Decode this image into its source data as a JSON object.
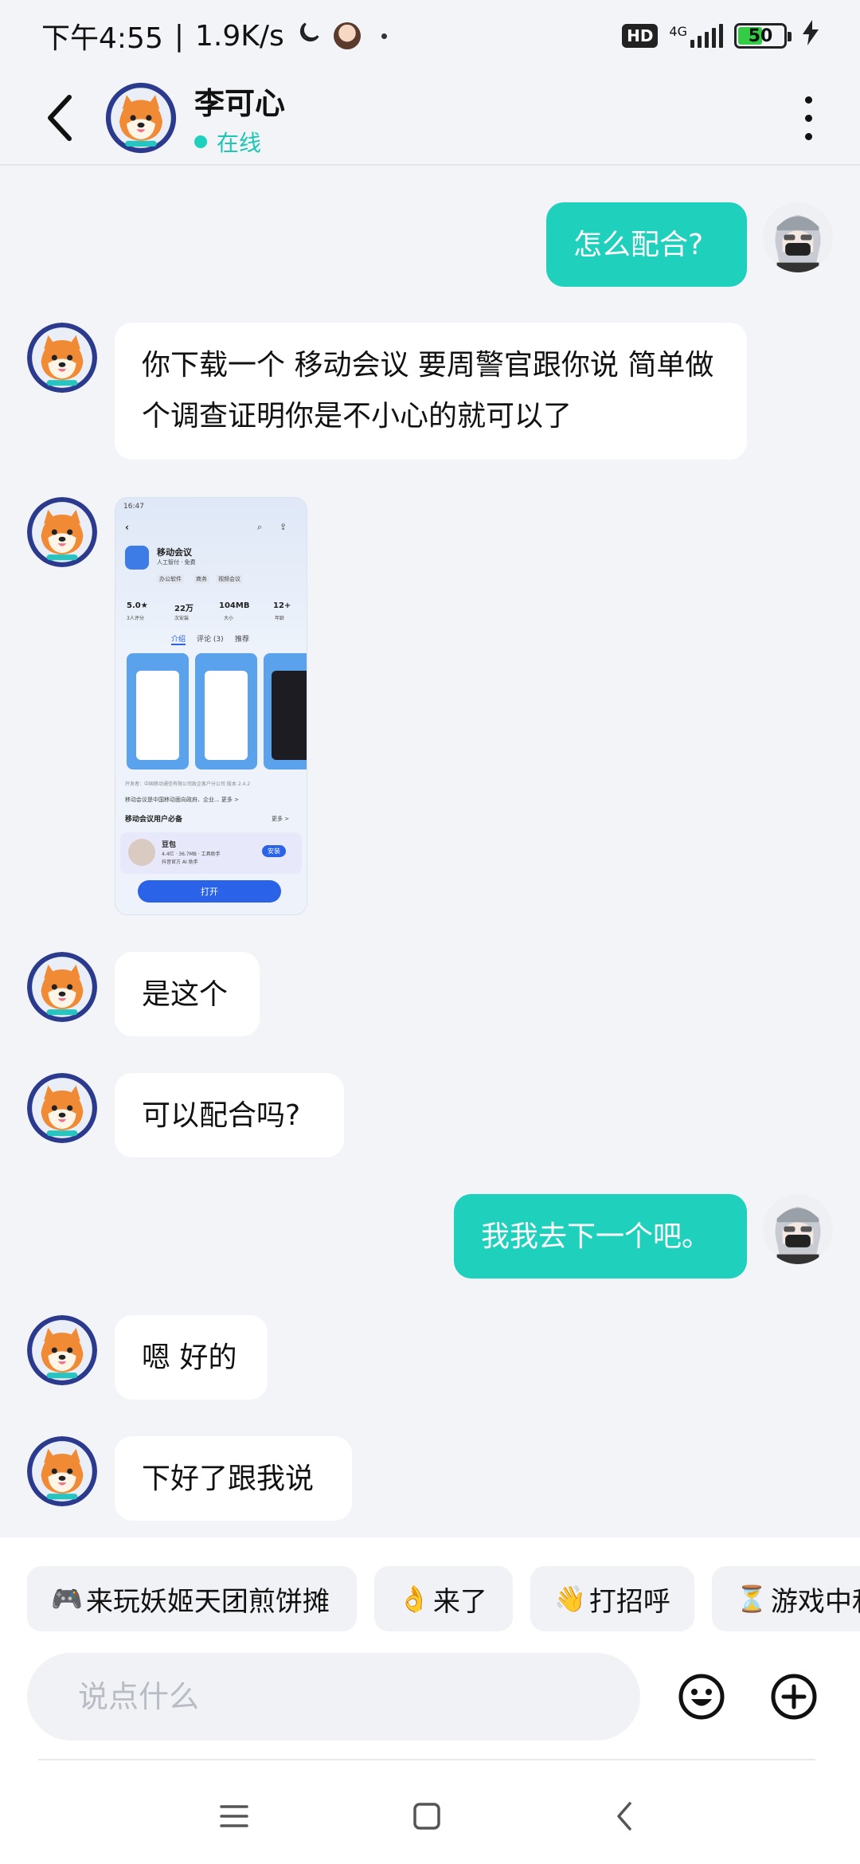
{
  "status_bar": {
    "time": "下午4:55",
    "speed": "1.9K/s",
    "hd": "HD",
    "network": "4G",
    "battery": "50"
  },
  "header": {
    "name": "李可心",
    "status": "在线"
  },
  "messages": [
    {
      "from": "me",
      "text": "怎么配合?"
    },
    {
      "from": "them",
      "text": "你下载一个 移动会议 要周警官跟你说 简单做个调查证明你是不小心的就可以了"
    },
    {
      "from": "them",
      "type": "image"
    },
    {
      "from": "them",
      "text": "是这个"
    },
    {
      "from": "them",
      "text": "可以配合吗?"
    },
    {
      "from": "me",
      "text": "我我去下一个吧。"
    },
    {
      "from": "them",
      "text": "嗯 好的"
    },
    {
      "from": "them",
      "text": "下好了跟我说"
    }
  ],
  "image_preview": {
    "time": "16:47",
    "app_name": "移动会议",
    "app_sub": "人工智付 · 免费",
    "tags": [
      "办公软件",
      "商务",
      "视频会议"
    ],
    "stats": [
      {
        "value": "5.0★",
        "label": "3人评分"
      },
      {
        "value": "22万",
        "label": "次安装"
      },
      {
        "value": "104MB",
        "label": "大小"
      },
      {
        "value": "12+",
        "label": "年龄"
      }
    ],
    "tabs": [
      "介绍",
      "评论 (3)",
      "推荐"
    ],
    "developer": "开发者：中国移动通信有限公司政企客户分公司   版本 2.4.2",
    "desc": "移动会议是中国移动面向政府、企业...   更多 >",
    "section": "移动会议用户必备",
    "section_more": "更多 >",
    "rec_app": "豆包",
    "rec_meta": "4.4亿 · 36.7MB · 工具助手",
    "rec_desc": "抖音官方 AI 助手",
    "install": "安装",
    "open": "打开"
  },
  "quick_replies": [
    {
      "emoji": "🎮",
      "label": "来玩妖姬天团煎饼摊"
    },
    {
      "emoji": "👌",
      "label": "来了"
    },
    {
      "emoji": "👋",
      "label": "打招呼"
    },
    {
      "emoji": "⏳",
      "label": "游戏中和"
    }
  ],
  "input": {
    "placeholder": "说点什么"
  },
  "colors": {
    "accent": "#1fd0bd",
    "background": "#f2f4f8",
    "bubble_them": "#ffffff"
  }
}
